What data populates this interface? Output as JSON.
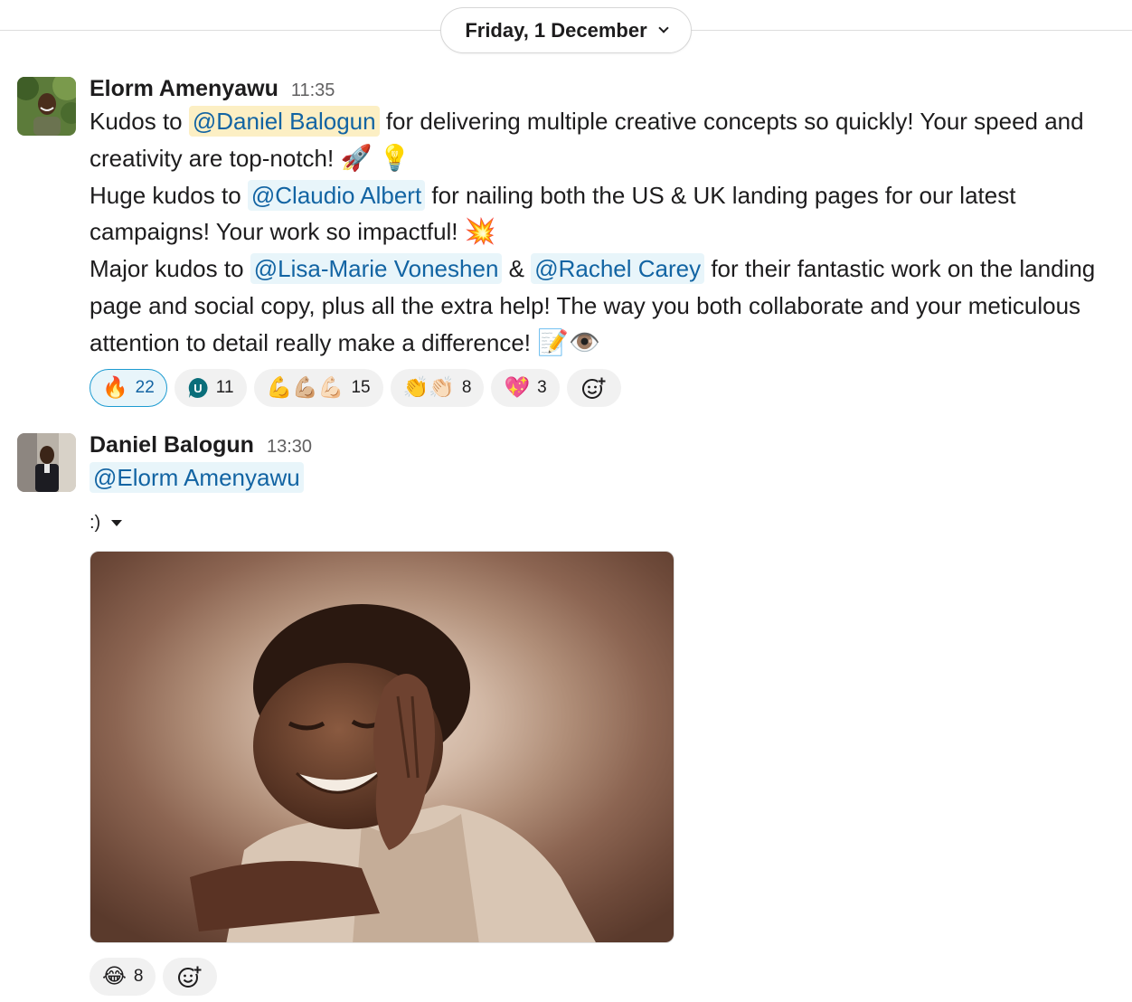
{
  "date_divider": {
    "label": "Friday, 1 December"
  },
  "messages": [
    {
      "author": "Elorm Amenyawu",
      "time": "11:35",
      "lines": {
        "l1_pre": "Kudos to ",
        "l1_mention": "@Daniel Balogun",
        "l1_post": " for delivering multiple creative concepts so quickly! Your speed and creativity are top-notch! ",
        "l1_emoji": "🚀 💡",
        "l2_pre": "Huge kudos to ",
        "l2_mention": "@Claudio Albert",
        "l2_post": " for nailing both the US & UK landing pages for our latest campaigns! Your work so impactful! ",
        "l2_emoji": "💥",
        "l3_pre": "Major kudos to ",
        "l3_mention_a": "@Lisa-Marie Voneshen",
        "l3_mid": " & ",
        "l3_mention_b": "@Rachel Carey",
        "l3_post": " for their fantastic work on the landing page and social copy, plus all the extra help! The way you both collaborate and your meticulous attention to detail really make a difference! ",
        "l3_emoji": "📝👁️"
      },
      "reactions": [
        {
          "emoji": "🔥",
          "count": "22",
          "active": true
        },
        {
          "emoji": "U",
          "count": "11",
          "icon": "custom-u-badge-icon"
        },
        {
          "emoji": "💪💪🏼💪🏻",
          "count": "15"
        },
        {
          "emoji": "👏👏🏻",
          "count": "8"
        },
        {
          "emoji": "💖",
          "count": "3"
        }
      ]
    },
    {
      "author": "Daniel Balogun",
      "time": "13:30",
      "mention": "@Elorm Amenyawu",
      "attachment_caption": ":)",
      "reactions": [
        {
          "emoji": "😂",
          "count": "8"
        }
      ]
    }
  ],
  "colors": {
    "mention_text": "#1264a3",
    "mention_bg": "#e8f5fa",
    "self_mention_bg": "#fcefc4",
    "active_reaction_border": "#1d9bd1"
  }
}
